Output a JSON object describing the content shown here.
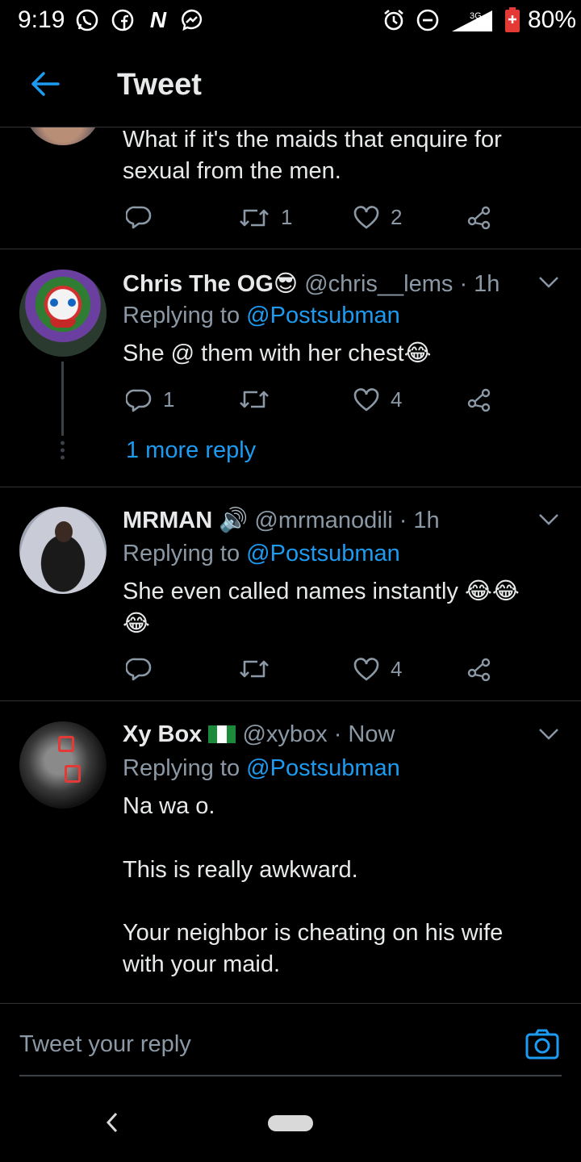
{
  "status_bar": {
    "time": "9:19",
    "battery": "80%",
    "network_tag": "3G"
  },
  "header": {
    "title": "Tweet"
  },
  "top_tweet": {
    "text_line1": "What if it's the maids that enquire for",
    "text_line2": "sexual from the men.",
    "retweets": "1",
    "likes": "2"
  },
  "tweets": [
    {
      "name": "Chris The OG",
      "name_emoji": "😎",
      "handle": "@chris__lems",
      "time": "· 1h",
      "replying_prefix": "Replying to",
      "replying_to": "@Postsubman",
      "text": "She @ them with her chest",
      "text_emoji": "😂",
      "replies": "1",
      "retweets": "",
      "likes": "4",
      "more_replies": "1 more reply"
    },
    {
      "name": "MRMAN",
      "name_emoji": "🔊",
      "handle": "@mrmanodili",
      "time": "· 1h",
      "replying_prefix": "Replying to",
      "replying_to": "@Postsubman",
      "text": "She even called names instantly",
      "text_emoji": "😂😂",
      "text_emoji2": "😂",
      "likes": "4"
    },
    {
      "name": "Xy Box",
      "handle": "@xybox",
      "time": "· Now",
      "replying_prefix": "Replying to",
      "replying_to": "@Postsubman",
      "para1": "Na wa o.",
      "para2": "This is really awkward.",
      "para3_line1": "Your neighbor is cheating on his wife",
      "para3_line2": "with your maid."
    }
  ],
  "reply_box": {
    "placeholder": "Tweet your reply"
  },
  "colors": {
    "background": "#000000",
    "accent": "#1d9bf0",
    "muted": "#8b98a5",
    "divider": "#2f3336"
  }
}
